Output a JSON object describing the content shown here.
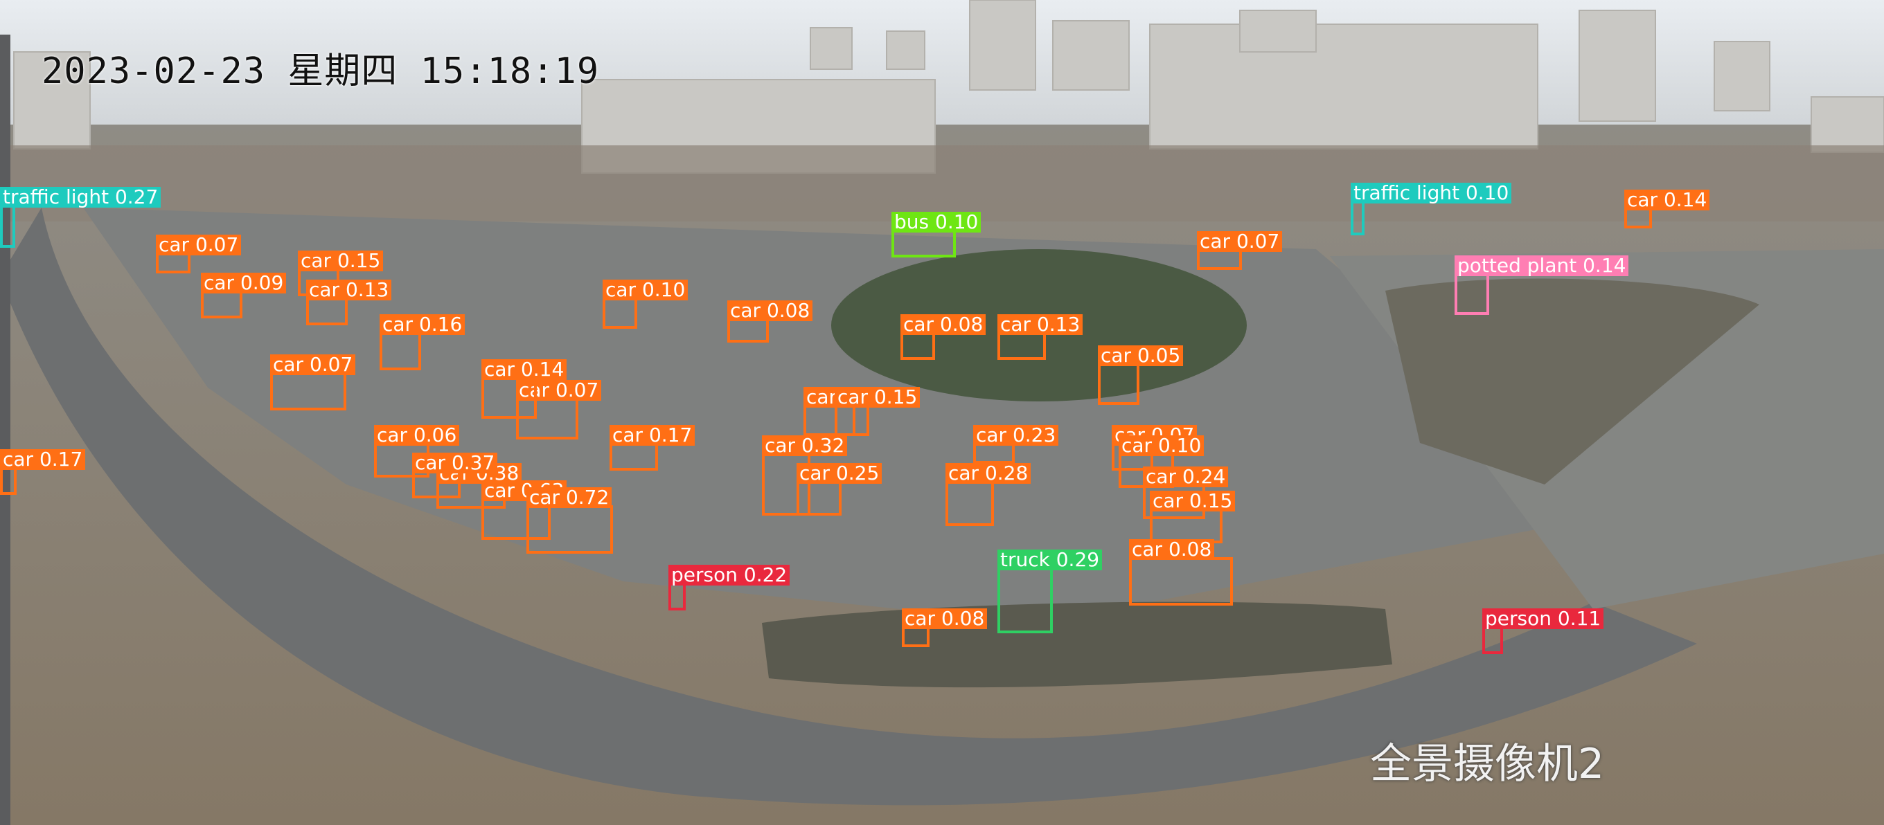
{
  "overlay": {
    "timestamp": "2023-02-23 星期四 15:18:19",
    "camera_name": "全景摄像机2"
  },
  "colors": {
    "car": "#ff6f15",
    "truck": "#2fd063",
    "bus": "#6ee613",
    "person": "#e9283d",
    "traffic light": "#1ecbbe",
    "potted plant": "#ff7eb3"
  },
  "detections": [
    {
      "label": "traffic light 0.27",
      "class": "traffic light"
    },
    {
      "label": "traffic light 0.10",
      "class": "traffic light"
    },
    {
      "label": "bus 0.10",
      "class": "bus"
    },
    {
      "label": "potted plant 0.14",
      "class": "potted plant"
    },
    {
      "label": "car 0.17",
      "class": "car"
    },
    {
      "label": "car 0.07",
      "class": "car"
    },
    {
      "label": "car 0.15",
      "class": "car"
    },
    {
      "label": "car 0.13",
      "class": "car"
    },
    {
      "label": "car 0.09",
      "class": "car"
    },
    {
      "label": "car 0.16",
      "class": "car"
    },
    {
      "label": "car 0.07",
      "class": "car"
    },
    {
      "label": "car 0.10",
      "class": "car"
    },
    {
      "label": "car 0.07",
      "class": "car"
    },
    {
      "label": "car 0.08",
      "class": "car"
    },
    {
      "label": "car 0.08",
      "class": "car"
    },
    {
      "label": "car 0.13",
      "class": "car"
    },
    {
      "label": "car 0.07",
      "class": "car"
    },
    {
      "label": "car 0.14",
      "class": "car"
    },
    {
      "label": "car 0.07",
      "class": "car"
    },
    {
      "label": "car 0.15",
      "class": "car"
    },
    {
      "label": "car 0.05",
      "class": "car"
    },
    {
      "label": "car 0.06",
      "class": "car"
    },
    {
      "label": "car 0.17",
      "class": "car"
    },
    {
      "label": "car 0.32",
      "class": "car"
    },
    {
      "label": "car 0.38",
      "class": "car"
    },
    {
      "label": "car 0.37",
      "class": "car"
    },
    {
      "label": "car 0.25",
      "class": "car"
    },
    {
      "label": "car 0.63",
      "class": "car"
    },
    {
      "label": "car 0.72",
      "class": "car"
    },
    {
      "label": "car 0.23",
      "class": "car"
    },
    {
      "label": "car 0.28",
      "class": "car"
    },
    {
      "label": "car 0.07",
      "class": "car"
    },
    {
      "label": "car 0.10",
      "class": "car"
    },
    {
      "label": "car 0.24",
      "class": "car"
    },
    {
      "label": "car 0.15",
      "class": "car"
    },
    {
      "label": "car 0.08",
      "class": "car"
    },
    {
      "label": "car 0.08",
      "class": "car"
    },
    {
      "label": "truck 0.29",
      "class": "truck"
    },
    {
      "label": "person 0.22",
      "class": "person"
    },
    {
      "label": "person 0.11",
      "class": "person"
    },
    {
      "label": "car 0.14",
      "class": "car"
    }
  ]
}
